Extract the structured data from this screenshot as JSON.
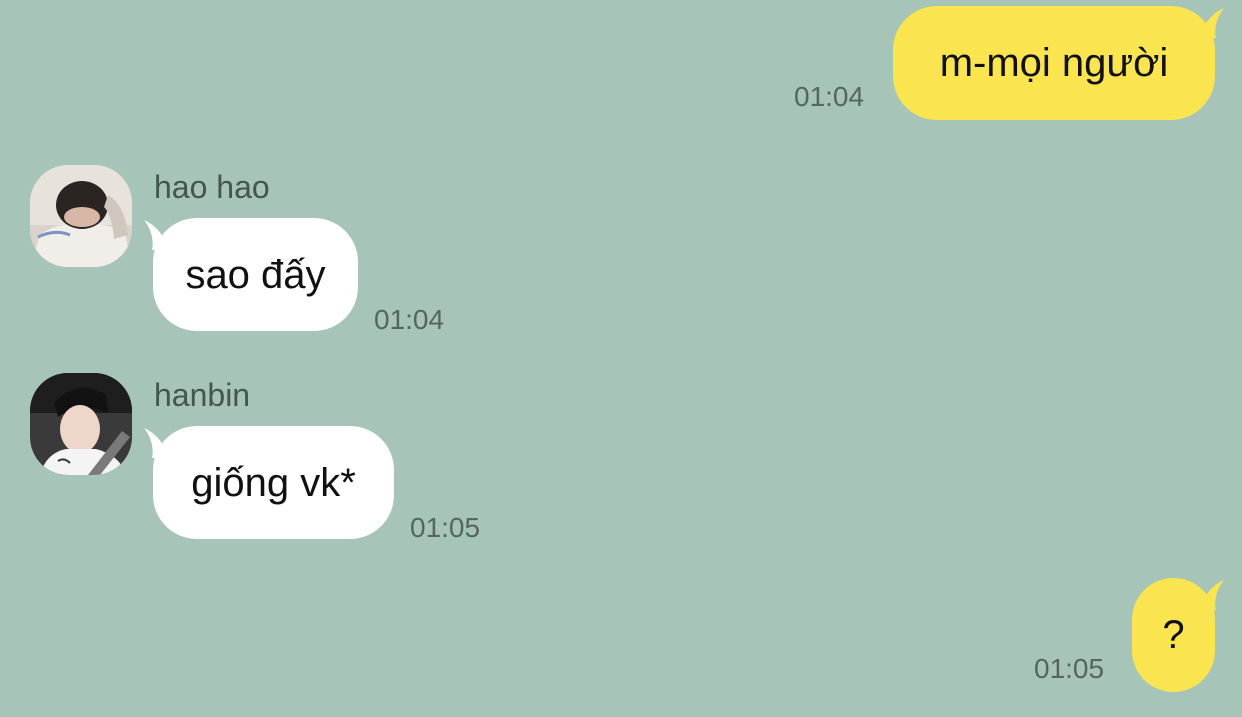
{
  "messages": [
    {
      "direction": "outgoing",
      "text": "m-mọi người",
      "time": "01:04"
    },
    {
      "direction": "incoming",
      "sender": "hao hao",
      "avatar_icon": "avatar-photo-icon",
      "text": "sao đấy",
      "time": "01:04"
    },
    {
      "direction": "incoming",
      "sender": "hanbin",
      "avatar_icon": "avatar-photo-icon",
      "text": "giống vk*",
      "time": "01:05"
    },
    {
      "direction": "outgoing",
      "text": "?",
      "time": "01:05"
    }
  ],
  "colors": {
    "background": "#a6c4b7",
    "outgoing_bubble": "#fae551",
    "incoming_bubble": "#ffffff",
    "timestamp": "#556661",
    "sender_name": "#44564f"
  }
}
